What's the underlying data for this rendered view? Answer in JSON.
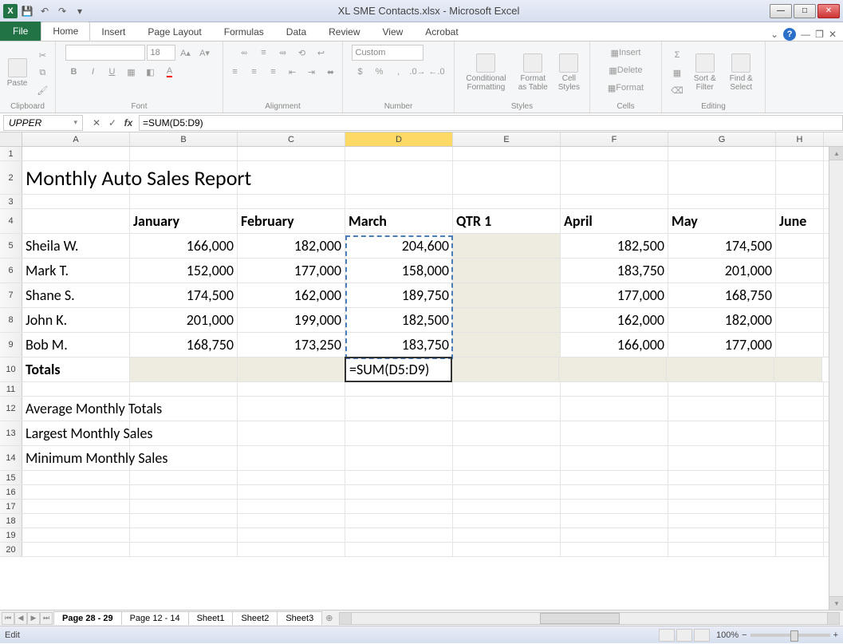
{
  "app": {
    "title": "XL SME Contacts.xlsx - Microsoft Excel"
  },
  "tabs": {
    "file": "File",
    "home": "Home",
    "insert": "Insert",
    "page_layout": "Page Layout",
    "formulas": "Formulas",
    "data": "Data",
    "review": "Review",
    "view": "View",
    "acrobat": "Acrobat"
  },
  "ribbon": {
    "clipboard": {
      "label": "Clipboard",
      "paste": "Paste"
    },
    "font": {
      "label": "Font",
      "size": "18"
    },
    "alignment": {
      "label": "Alignment"
    },
    "number": {
      "label": "Number",
      "format": "Custom"
    },
    "styles": {
      "label": "Styles",
      "cond": "Conditional\nFormatting",
      "table": "Format\nas Table",
      "cell": "Cell\nStyles"
    },
    "cells": {
      "label": "Cells",
      "insert": "Insert",
      "delete": "Delete",
      "format": "Format"
    },
    "editing": {
      "label": "Editing",
      "sort": "Sort &\nFilter",
      "find": "Find &\nSelect"
    }
  },
  "formula_bar": {
    "name_box": "UPPER",
    "cancel": "✕",
    "enter": "✓",
    "fx": "fx",
    "formula": "=SUM(D5:D9)"
  },
  "columns": [
    "A",
    "B",
    "C",
    "D",
    "E",
    "F",
    "G",
    "H"
  ],
  "active_col": "D",
  "sheet": {
    "title": "Monthly Auto Sales Report",
    "headers": {
      "jan": "January",
      "feb": "February",
      "mar": "March",
      "qtr1": "QTR 1",
      "apr": "April",
      "may": "May",
      "jun": "June"
    },
    "rows": [
      {
        "name": "Sheila W.",
        "jan": "166,000",
        "feb": "182,000",
        "mar": "204,600",
        "apr": "182,500",
        "may": "174,500"
      },
      {
        "name": "Mark T.",
        "jan": "152,000",
        "feb": "177,000",
        "mar": "158,000",
        "apr": "183,750",
        "may": "201,000"
      },
      {
        "name": "Shane S.",
        "jan": "174,500",
        "feb": "162,000",
        "mar": "189,750",
        "apr": "177,000",
        "may": "168,750"
      },
      {
        "name": "John K.",
        "jan": "201,000",
        "feb": "199,000",
        "mar": "182,500",
        "apr": "162,000",
        "may": "182,000"
      },
      {
        "name": "Bob M.",
        "jan": "168,750",
        "feb": "173,250",
        "mar": "183,750",
        "apr": "166,000",
        "may": "177,000"
      }
    ],
    "totals_label": "Totals",
    "editing_formula": "=SUM(D5:D9)",
    "summary": {
      "avg": "Average Monthly Totals",
      "max": "Largest Monthly Sales",
      "min": "Minimum Monthly Sales"
    }
  },
  "sheet_tabs": [
    "Page 28 - 29",
    "Page 12 - 14",
    "Sheet1",
    "Sheet2",
    "Sheet3"
  ],
  "status": {
    "mode": "Edit",
    "zoom": "100%"
  }
}
